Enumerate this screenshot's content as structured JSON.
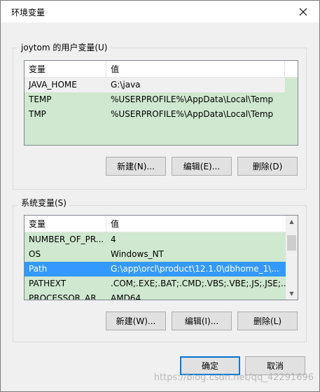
{
  "window": {
    "title": "环境变量",
    "close_symbol": "✕"
  },
  "user_vars": {
    "group_label": "joytom 的用户变量(U)",
    "columns": [
      "变量",
      "值"
    ],
    "rows": [
      {
        "name": "JAVA_HOME",
        "value": "G:\\java"
      },
      {
        "name": "TEMP",
        "value": "%USERPROFILE%\\AppData\\Local\\Temp"
      },
      {
        "name": "TMP",
        "value": "%USERPROFILE%\\AppData\\Local\\Temp"
      }
    ],
    "buttons": {
      "new": "新建(N)...",
      "edit": "编辑(E)...",
      "delete": "删除(D)"
    }
  },
  "system_vars": {
    "group_label": "系统变量(S)",
    "columns": [
      "变量",
      "值"
    ],
    "rows": [
      {
        "name": "NUMBER_OF_PR...",
        "value": "4"
      },
      {
        "name": "OS",
        "value": "Windows_NT"
      },
      {
        "name": "Path",
        "value": "G:\\app\\orcl\\product\\12.1.0\\dbhome_1\\..."
      },
      {
        "name": "PATHEXT",
        "value": ".COM;.EXE;.BAT;.CMD;.VBS;.VBE;.JS;.JSE;..."
      },
      {
        "name": "PROCESSOR_AR...",
        "value": "AMD64"
      }
    ],
    "buttons": {
      "new": "新建(W)...",
      "edit": "编辑(I)...",
      "delete": "删除(L)"
    }
  },
  "footer": {
    "ok": "确定",
    "cancel": "取消"
  },
  "watermark": "https://blog.csdn.net/qq_42291696",
  "colors": {
    "row_bg": "#cfe8cf",
    "selected": "#3399ff",
    "accent": "#0078d7"
  }
}
